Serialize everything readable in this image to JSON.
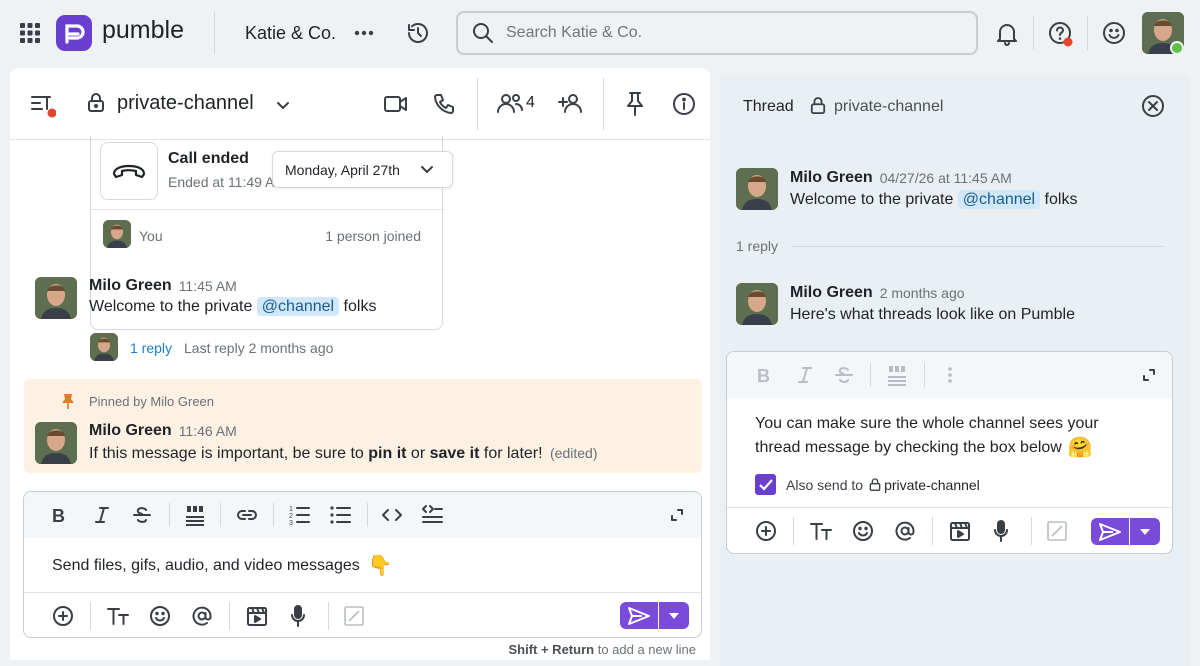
{
  "app": {
    "name": "pumble",
    "brand_color": "#6a3fd0"
  },
  "topbar": {
    "workspace": "Katie & Co.",
    "search_placeholder": "Search Katie & Co."
  },
  "channel": {
    "name": "private-channel",
    "member_count": "4"
  },
  "call_card": {
    "title": "Call ended",
    "subtitle": "Ended at 11:49 AM",
    "you_label": "You",
    "joined": "1 person joined"
  },
  "date_picker": {
    "label": "Monday, April 27th"
  },
  "messages": [
    {
      "author": "Milo Green",
      "time": "11:45 AM",
      "text_pre": "Welcome to the private",
      "mention": "@channel",
      "text_post": "folks",
      "reply_count": "1 reply",
      "last_reply": "Last reply 2 months ago"
    },
    {
      "pinned_label": "Pinned by Milo Green",
      "author": "Milo Green",
      "time": "11:46 AM",
      "t1": "If this message is important, be sure to",
      "b1": "pin it",
      "t2": "or",
      "b2": "save it",
      "t3": "for later!",
      "edited": "(edited)"
    }
  ],
  "composer": {
    "text": "Send files, gifs, audio, and video messages",
    "emoji": "👇",
    "hint_bold": "Shift + Return",
    "hint_rest": "to add a new line"
  },
  "thread": {
    "title": "Thread",
    "channel": "private-channel",
    "parent": {
      "author": "Milo Green",
      "time": "04/27/26 at 11:45 AM",
      "text_pre": "Welcome to the private",
      "mention": "@channel",
      "text_post": "folks"
    },
    "replies_label": "1 reply",
    "reply": {
      "author": "Milo Green",
      "time": "2 months ago",
      "text": "Here's what threads look like on Pumble"
    },
    "composer": {
      "line1": "You can make sure the whole channel sees your",
      "line2": "thread message by checking the box below",
      "emoji": "🤗",
      "also_send": "Also send to",
      "also_channel": "private-channel"
    }
  }
}
